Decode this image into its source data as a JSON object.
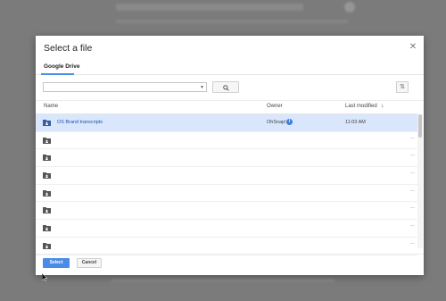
{
  "dialog": {
    "title": "Select a file",
    "close_icon": "close-icon",
    "tabs": [
      {
        "label": "Google Drive",
        "active": true
      }
    ]
  },
  "toolbar": {
    "search_value": "",
    "search_button_icon": "search-icon",
    "sort_button_icon": "sort-icon"
  },
  "table": {
    "columns": {
      "name": "Name",
      "owner": "Owner",
      "last_modified": "Last modified"
    },
    "sort_direction_icon": "arrow-down-icon",
    "rows": [
      {
        "name": "OS Brand transcripts",
        "owner": "OhSnap!",
        "modified": "11:03 AM",
        "selected": true,
        "icon": "shared-folder-icon"
      },
      {
        "name": "",
        "owner": "",
        "modified": "",
        "icon": "shared-folder-icon"
      },
      {
        "name": "",
        "owner": "",
        "modified": "",
        "icon": "shared-folder-icon"
      },
      {
        "name": "",
        "owner": "",
        "modified": "",
        "icon": "shared-folder-icon"
      },
      {
        "name": "",
        "owner": "",
        "modified": "",
        "icon": "shared-folder-icon"
      },
      {
        "name": "",
        "owner": "",
        "modified": "",
        "icon": "shared-folder-icon"
      },
      {
        "name": "",
        "owner": "",
        "modified": "",
        "icon": "shared-folder-icon"
      },
      {
        "name": "",
        "owner": "",
        "modified": "",
        "icon": "shared-folder-icon"
      }
    ]
  },
  "footer": {
    "select_label": "Select",
    "cancel_label": "Cancel"
  },
  "colors": {
    "accent": "#4a8be8",
    "selected_row": "#d9e6fb",
    "link": "#1a56b0",
    "overlay": "#7b7b7b"
  }
}
